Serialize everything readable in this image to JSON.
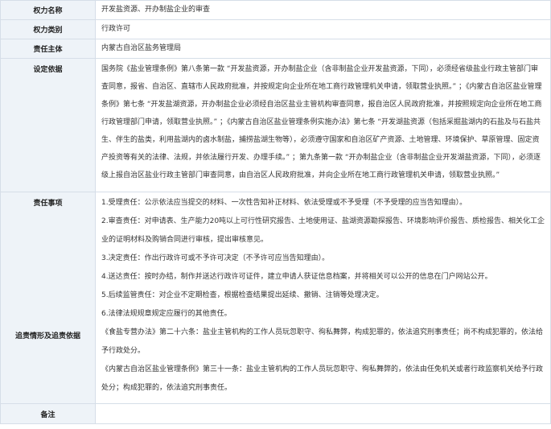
{
  "rows": {
    "name": {
      "label": "权力名称",
      "value": "开发盐资源、开办制盐企业的审查"
    },
    "category": {
      "label": "权力类别",
      "value": "行政许可"
    },
    "subject": {
      "label": "责任主体",
      "value": "内蒙古自治区盐务管理局"
    },
    "basis": {
      "label": "设定依据",
      "value": "国务院《盐业管理条例》第八条第一款 “开发盐资源，开办制盐企业（含非制盐企业开发盐资源，下同），必须经省级盐业行政主管部门审查同意，报省、自治区、直辖市人民政府批准，并按规定向企业所在地工商行政管理机关申请，领取营业执照。” ；《内蒙古自治区盐业管理条例》第七条 “开发盐湖资源，开办制盐企业必须经自治区盐业主管机构审查同意，报自治区人民政府批准，并按照规定向企业所在地工商行政管理部门申请，领取营业执照。” ；《内蒙古自治区盐业管理条例实施办法》第七条 “开发湖盐资源（包括采掘盐湖内的石盐及与石盐共生、伴生的盐类，利用盐湖内的卤水制盐，捕捞盐湖生物等），必须遵守国家和自治区矿产资源、土地管理、环境保护、草原管理、固定资产投资等有关的法律、法规，并依法履行开发、办理手续。” ；第九条第一款 “开办制盐企业（含非制盐企业开发湖盐资源，下同），必须逐级上报自治区盐业行政主管部门审查同意，由自治区人民政府批准，并向企业所在地工商行政管理机关申请，领取营业执照。”"
    },
    "duties": {
      "label": "责任事项",
      "items": [
        "1.受理责任：公示依法应当提交的材料、一次性告知补正材料、依法受理或不予受理（不予受理的应当告知理由）。",
        "2.审查责任：对申请表、生产能力20吨以上可行性研究报告、土地使用证、盐湖资源勘探报告、环境影响评价报告、质检报告、相关化工企业的证明材料及购销合同进行审核，提出审核意见。",
        "3.决定责任：作出行政许可或不予许可决定（不予许可应当告知理由）。",
        "4.送达责任：按时办结，制作并送达行政许可证件，建立申请人获证信息档案，并将相关可以公开的信息在门户网站公开。",
        "5.后续监管责任：对企业不定期检查，根据检查结果提出延续、撤销、注销等处理决定。",
        "6.法律法规规章规定应履行的其他责任。"
      ]
    },
    "liability": {
      "label": "追责情形及追责依据",
      "items": [
        "《食盐专营办法》第二十六条：盐业主管机构的工作人员玩忽职守、徇私舞弊，构成犯罪的，依法追究刑事责任；尚不构成犯罪的，依法给予行政处分。",
        "《内蒙古自治区盐业管理条例》第三十一条：盐业主管机构的工作人员玩忽职守、徇私舞弊的，依法由任免机关或者行政监察机关给予行政处分；构成犯罪的，依法追究刑事责任。"
      ]
    },
    "remarks": {
      "label": "备注",
      "value": ""
    }
  }
}
